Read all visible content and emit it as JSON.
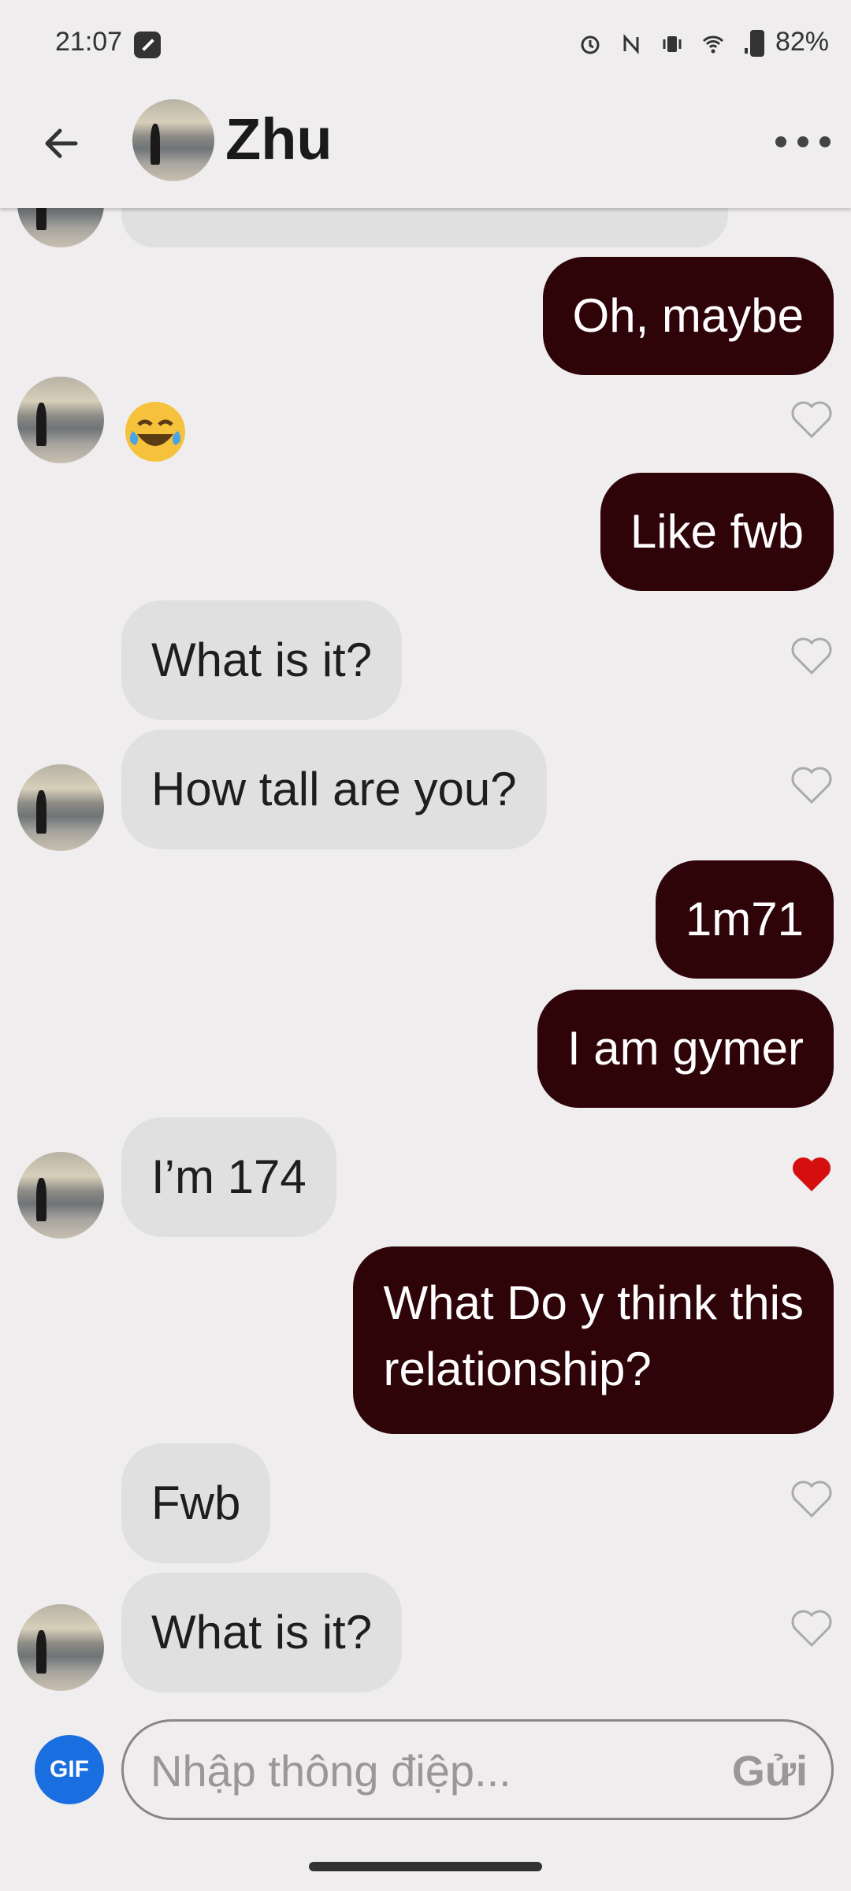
{
  "status": {
    "time": "21:07",
    "battery": "82%"
  },
  "header": {
    "name": "Zhu"
  },
  "messages": [
    {
      "side": "out",
      "text": "Oh, maybe"
    },
    {
      "side": "in",
      "text": "😂",
      "liked": false
    },
    {
      "side": "out",
      "text": "Like fwb"
    },
    {
      "side": "in",
      "text": "What is it?",
      "liked": false
    },
    {
      "side": "in",
      "text": "How tall are you?",
      "liked": false
    },
    {
      "side": "out",
      "text": "1m71"
    },
    {
      "side": "out",
      "text": "I am gymer"
    },
    {
      "side": "in",
      "text": "I’m 174",
      "liked": true
    },
    {
      "side": "out",
      "text": "What Do y think this",
      "text2": "relationship?"
    },
    {
      "side": "in",
      "text": "Fwb",
      "liked": false
    },
    {
      "side": "in",
      "text": "What is it?",
      "liked": false
    }
  ],
  "composer": {
    "gif_label": "GIF",
    "placeholder": "Nhập thông điệp...",
    "send_label": "Gửi"
  },
  "colors": {
    "outgoing_bubble": "#2f0409",
    "incoming_bubble": "#e1e0e0",
    "heart_liked": "#d50f0f",
    "gif_button": "#1a6fe0"
  }
}
